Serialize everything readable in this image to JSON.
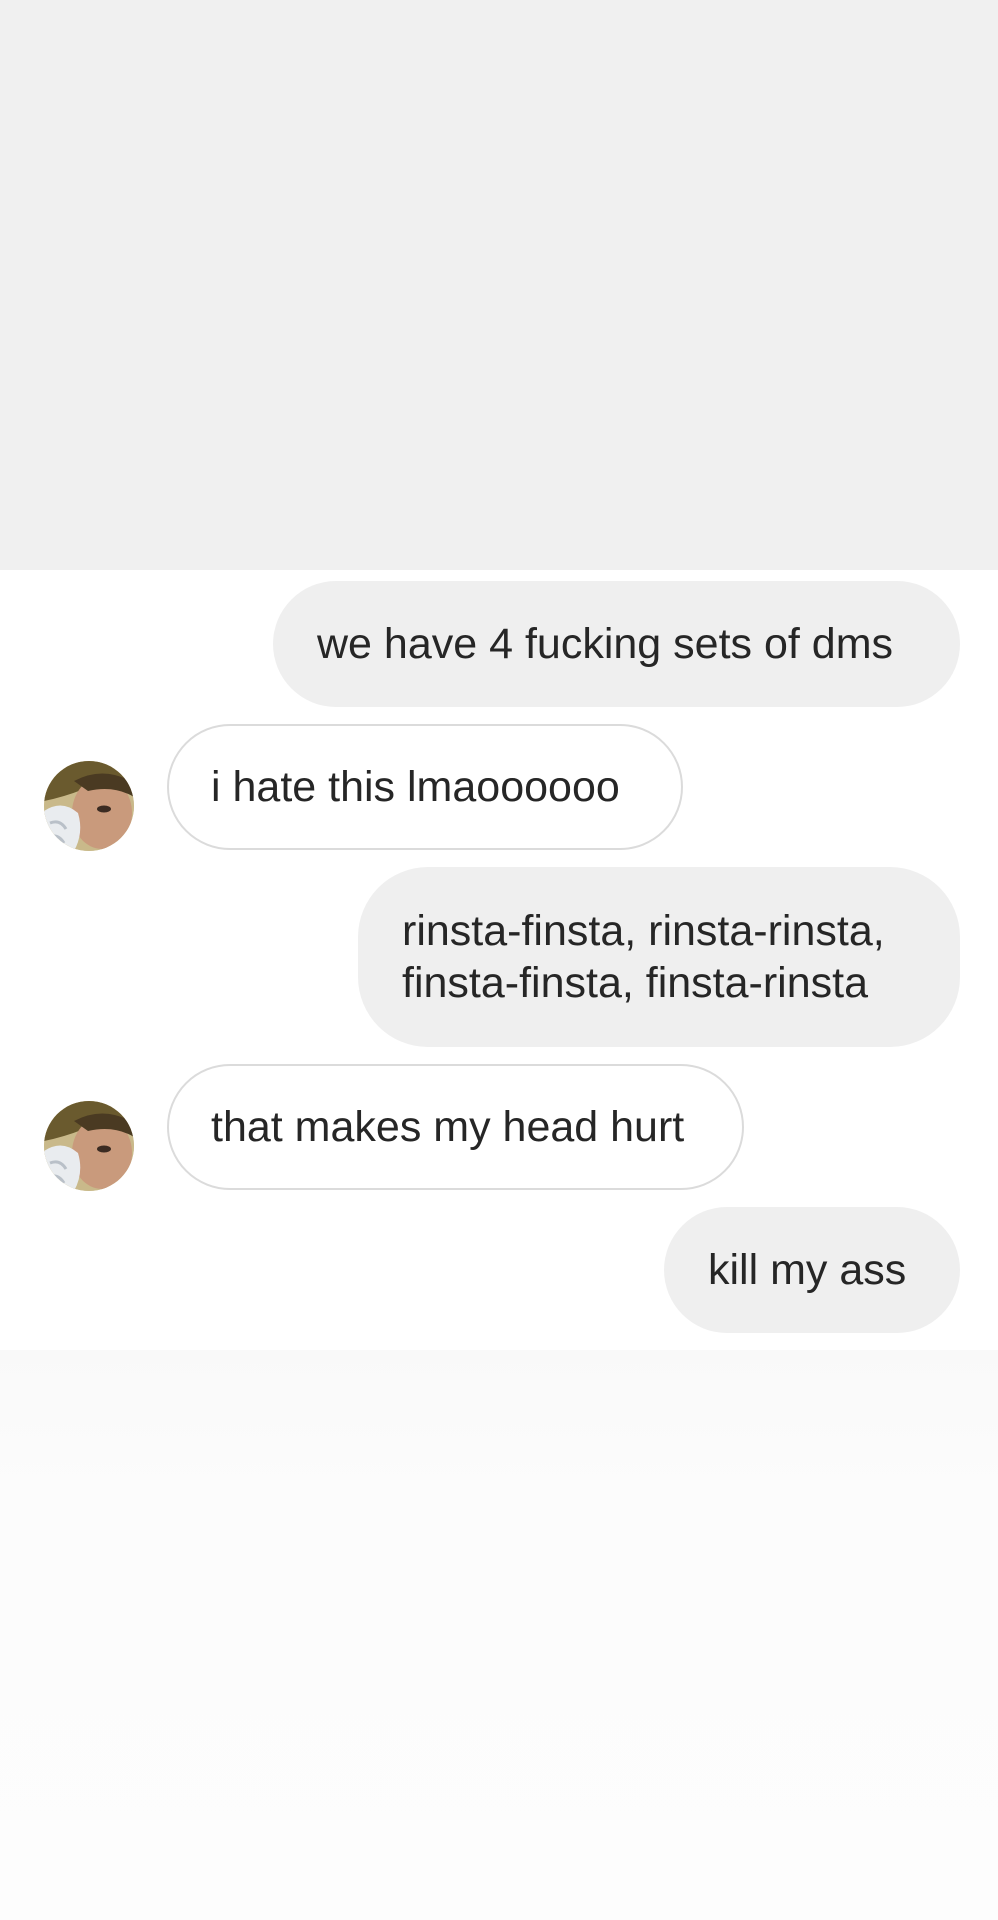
{
  "conversation": {
    "messages": [
      {
        "sender": "me",
        "text": "we have 4 fucking sets of dms"
      },
      {
        "sender": "them",
        "text": "i hate this lmaoooooo",
        "avatar_icon": "user-avatar-icon"
      },
      {
        "sender": "me",
        "text": "rinsta-finsta, rinsta-rinsta,\nfinsta-finsta, finsta-rinsta"
      },
      {
        "sender": "them",
        "text": "that makes my head hurt",
        "avatar_icon": "user-avatar-icon"
      },
      {
        "sender": "me",
        "text": "kill my ass"
      }
    ]
  },
  "colors": {
    "sent_bubble": "#efefef",
    "received_bubble_border": "#dbdbdb",
    "text": "#262626",
    "top_background": "#f0f0f0",
    "chat_background": "#ffffff"
  }
}
